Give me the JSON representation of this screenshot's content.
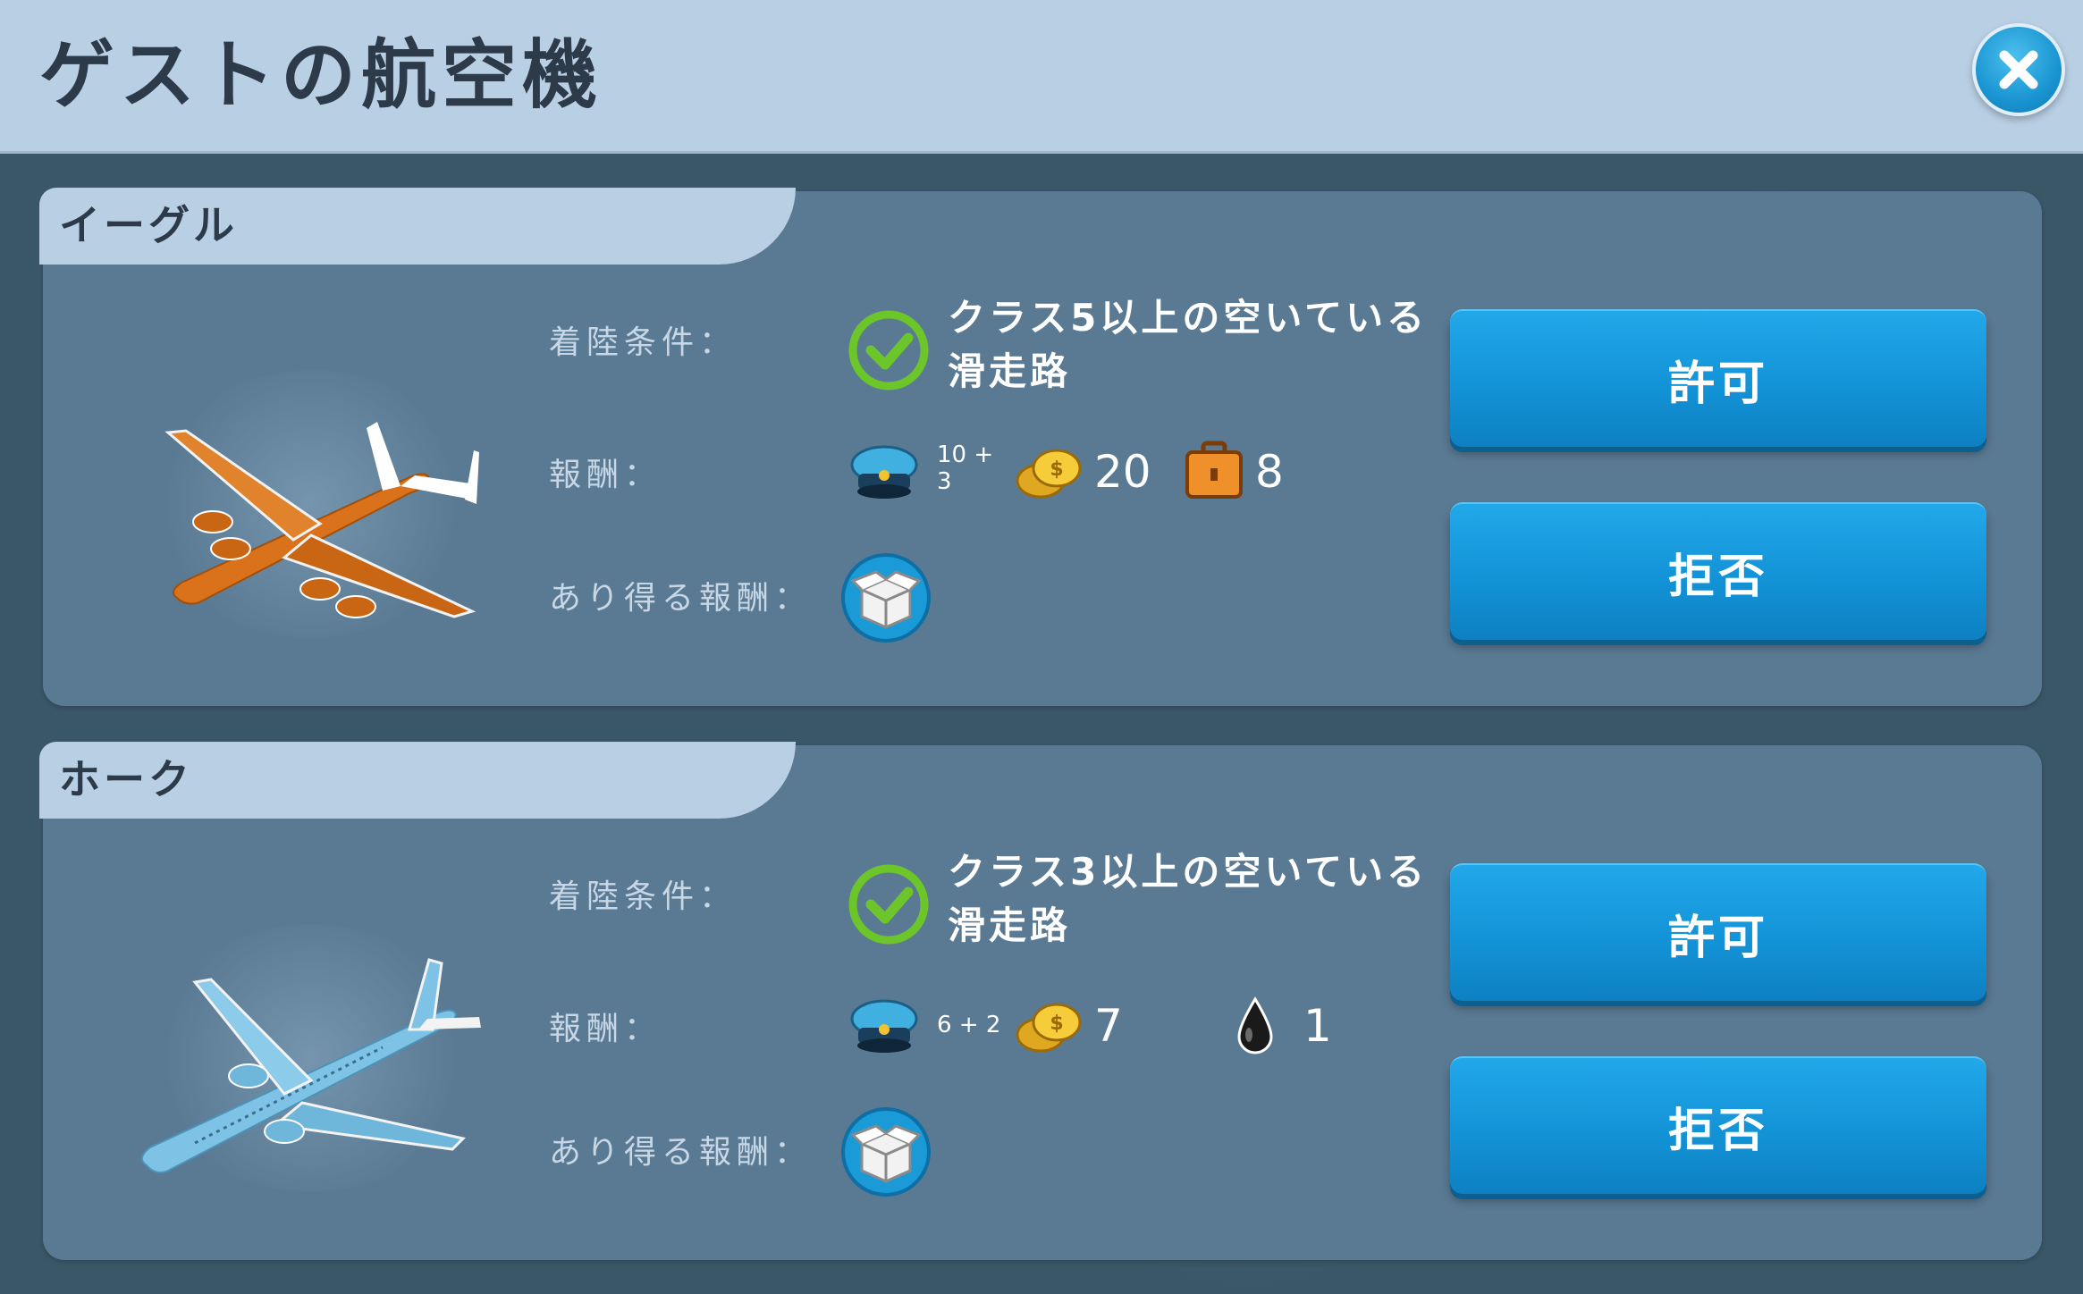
{
  "header": {
    "title": "ゲストの航空機"
  },
  "close_icon": "close-icon",
  "labels": {
    "landing_condition": "着陸条件：",
    "reward": "報酬：",
    "possible_reward": "あり得る報酬："
  },
  "cards": [
    {
      "name": "イーグル",
      "plane_color": "#d9721a",
      "condition": "クラス5以上の空いている滑走路",
      "rewards": {
        "pilot_base": "10 +",
        "pilot_bonus": "3",
        "coins": "20",
        "third_value": "8",
        "third_icon": "suitcase-icon"
      },
      "possible_reward_icon": "mystery-box-icon",
      "accept_label": "許可",
      "reject_label": "拒否"
    },
    {
      "name": "ホーク",
      "plane_color": "#7ec3e6",
      "condition": "クラス3以上の空いている滑走路",
      "rewards": {
        "pilot_base": "6 + 2",
        "coins": "7",
        "third_value": "1",
        "third_icon": "oil-drop-icon"
      },
      "possible_reward_icon": "mystery-box-icon",
      "accept_label": "許可",
      "reject_label": "拒否"
    }
  ],
  "colors": {
    "header_bg": "#b9cfe4",
    "card_bg": "#5a7a93",
    "button_blue": "#1393d7",
    "check_green": "#6cc62a"
  }
}
